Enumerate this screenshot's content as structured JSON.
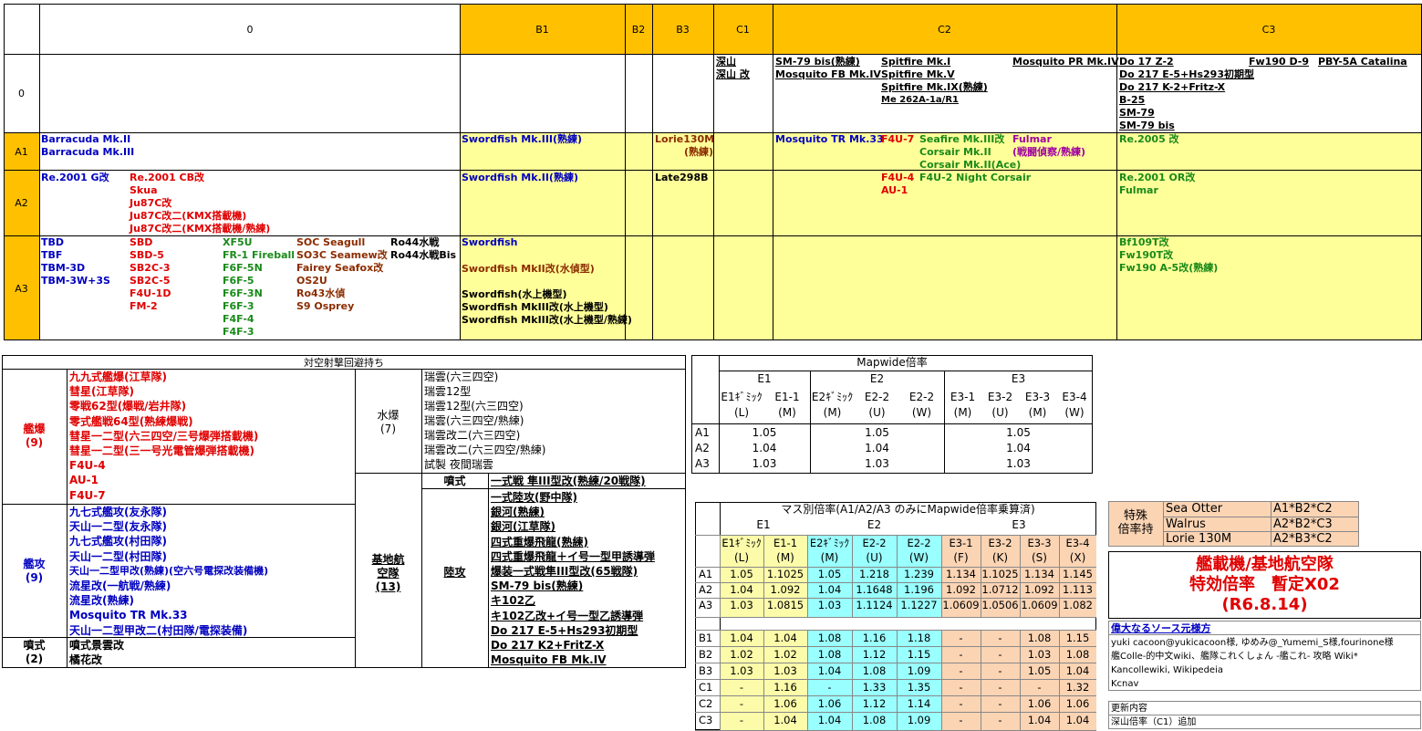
{
  "top": {
    "headers": [
      "0",
      "B1",
      "B2",
      "B3",
      "C1",
      "C2",
      "C3"
    ],
    "rows": [
      "0",
      "A1",
      "A2",
      "A3"
    ],
    "r0": {
      "c1": [
        "深山",
        "深山 改"
      ],
      "c2a": [
        "SM-79 bis(熟練)",
        "Mosquito FB Mk.IV"
      ],
      "c2b": [
        "Spitfire Mk.I",
        "Spitfire Mk.V",
        "Spitfire Mk.IX(熟練)",
        "Me 262A-1a/R1"
      ],
      "c2c": "Mosquito PR Mk.IV",
      "c3a": [
        "Do 17 Z-2",
        "Do 217 E-5+Hs293初期型",
        "Do 217 K-2+Fritz-X",
        "B-25",
        "SM-79",
        "SM-79 bis"
      ],
      "c3b": "Fw190 D-9",
      "c3c": "PBY-5A Catalina"
    },
    "a1": {
      "c0": [
        "Barracuda Mk.II",
        "Barracuda Mk.III"
      ],
      "b1": "Swordfish Mk.III(熟練)",
      "b3": [
        "Lorie130M",
        "(熟練)"
      ],
      "c2a": "Mosquito TR Mk.33",
      "c2b": "F4U-7",
      "c2c": [
        "Seafire Mk.III改",
        "Corsair Mk.II",
        "Corsair Mk.II(Ace)"
      ],
      "c2d": [
        "Fulmar",
        "(戦闘偵察/熟練)"
      ],
      "c3": "Re.2005 改"
    },
    "a2": {
      "c0a": "Re.2001 G改",
      "c0b": [
        "Re.2001 CB改",
        "Skua",
        "Ju87C改",
        "Ju87C改二(KMX搭載機)",
        "Ju87C改二(KMX搭載機/熟練)"
      ],
      "b1": "Swordfish Mk.II(熟練)",
      "b3": "Late298B",
      "c2a": [
        "F4U-4",
        "AU-1"
      ],
      "c2b": "F4U-2 Night Corsair",
      "c3": [
        "Re.2001 OR改",
        "Fulmar"
      ]
    },
    "a3": {
      "c0a": [
        "TBD",
        "TBF",
        "TBM-3D",
        "TBM-3W+3S"
      ],
      "c0b": [
        "SBD",
        "SBD-5",
        "SB2C-3",
        "SB2C-5",
        "F4U-1D",
        "FM-2"
      ],
      "c0c": [
        "XF5U",
        "FR-1 Fireball",
        "F6F-5N",
        "F6F-5",
        "F6F-3N",
        "F6F-3",
        "F4F-4",
        "F4F-3"
      ],
      "c0d": [
        "SOC Seagull",
        "SO3C Seamew改",
        "Fairey Seafox改",
        "OS2U",
        "Ro43水偵",
        "S9 Osprey"
      ],
      "c0e": [
        "Ro44水戦",
        "Ro44水戦Bis"
      ],
      "b1a": "Swordfish",
      "b1b": "Swordfish MkII改(水偵型)",
      "b1c": [
        "Swordfish(水上機型)",
        "Swordfish MkIII改(水上機型)",
        "Swordfish MkIII改(水上機型/熟練)"
      ],
      "c3a": [
        "Bf109T改",
        "Fw190T改"
      ],
      "c3b": "Fw190 A-5改(熟練)"
    }
  },
  "aa": {
    "title": "対空射撃回避持ち",
    "kanbaku": {
      "label": "艦爆",
      "count": "(9)",
      "items": [
        "九九式艦爆(江草隊)",
        "彗星(江草隊)",
        "零戦62型(爆戦/岩井隊)",
        "零式艦戦64型(熟練爆戦)",
        "彗星一二型(六三四空/三号爆弾搭載機)",
        "彗星一二型(三一号光電管爆弾搭載機)",
        "F4U-4",
        "AU-1",
        "F4U-7"
      ]
    },
    "kanko": {
      "label": "艦攻",
      "count": "(9)",
      "items": [
        "九七式艦攻(友永隊)",
        "天山一二型(友永隊)",
        "九七式艦攻(村田隊)",
        "天山一二型(村田隊)",
        "天山一二型甲改(熟練)(空六号電探改装備機)",
        "流星改(一航戦/熟練)",
        "流星改(熟練)",
        "Mosquito TR Mk.33",
        "天山一二型甲改二(村田隊/電探装備)"
      ]
    },
    "funshiki": {
      "label": "噴式",
      "count": "(2)",
      "items": [
        "噴式景雲改",
        "橘花改"
      ]
    },
    "suibaku": {
      "label": "水爆",
      "count": "(7)",
      "items": [
        "瑞雲(六三四空)",
        "瑞雲12型",
        "瑞雲12型(六三四空)",
        "瑞雲(六三四空/熟練)",
        "瑞雲改二(六三四空)",
        "瑞雲改二(六三四空/熟練)",
        "試製 夜間瑞雲"
      ]
    },
    "kichi": {
      "label": "基地航空隊",
      "count": "(13)",
      "sub1": "噴式",
      "sub1items": [
        "一式戦 隼III型改(熟練/20戦隊)"
      ],
      "sub2": "陸攻",
      "sub2items": [
        "一式陸攻(野中隊)",
        "銀河(熟練)",
        "銀河(江草隊)",
        "四式重爆飛龍(熟練)",
        "四式重爆飛龍＋イ号一型甲誘導弾",
        "爆装一式戦隼III型改(65戦隊)",
        "SM-79 bis(熟練)",
        "キ102乙",
        "キ102乙改+イ号一型乙誘導弾",
        "Do 217 E-5+Hs293初期型",
        "Do 217 K2+FritZ-X",
        "Mosquito FB Mk.IV"
      ]
    }
  },
  "mapwide": {
    "title": "Mapwide倍率",
    "groups": [
      "E1",
      "E2",
      "E3"
    ],
    "cols": [
      "E1ｷﾞﾐｯｸ",
      "E1-1",
      "E2ｷﾞﾐｯｸ",
      "E2-2",
      "E2-2",
      "E3-1",
      "E3-2",
      "E3-3",
      "E3-4"
    ],
    "sub": [
      "(L)",
      "(M)",
      "(M)",
      "(U)",
      "(W)",
      "(M)",
      "(U)",
      "(M)",
      "(W)"
    ],
    "rows": [
      [
        "A1",
        "1.05",
        "1.05",
        "1.05"
      ],
      [
        "A2",
        "1.04",
        "1.04",
        "1.04"
      ],
      [
        "A3",
        "1.03",
        "1.03",
        "1.03"
      ]
    ]
  },
  "mass": {
    "title": "マス別倍率(A1/A2/A3 のみにMapwide倍率乗算済)",
    "groups": [
      "E1",
      "E2",
      "E3"
    ],
    "cols": [
      "E1ｷﾞﾐｯｸ",
      "E1-1",
      "E2ｷﾞﾐｯｸ",
      "E2-2",
      "E2-2",
      "E3-1",
      "E3-2",
      "E3-3",
      "E3-4"
    ],
    "sub": [
      "(L)",
      "(M)",
      "(M)",
      "(U)",
      "(W)",
      "(F)",
      "(K)",
      "(S)",
      "(X)"
    ],
    "rowsA": [
      [
        "A1",
        "1.05",
        "1.1025",
        "1.05",
        "1.218",
        "1.239",
        "1.134",
        "1.1025",
        "1.134",
        "1.145"
      ],
      [
        "A2",
        "1.04",
        "1.092",
        "1.04",
        "1.1648",
        "1.196",
        "1.092",
        "1.0712",
        "1.092",
        "1.113"
      ],
      [
        "A3",
        "1.03",
        "1.0815",
        "1.03",
        "1.1124",
        "1.1227",
        "1.0609",
        "1.0506",
        "1.0609",
        "1.082"
      ]
    ],
    "rowsB": [
      [
        "B1",
        "1.04",
        "1.04",
        "1.08",
        "1.16",
        "1.18",
        "-",
        "-",
        "1.08",
        "1.15"
      ],
      [
        "B2",
        "1.02",
        "1.02",
        "1.08",
        "1.12",
        "1.15",
        "-",
        "-",
        "1.03",
        "1.08"
      ],
      [
        "B3",
        "1.03",
        "1.03",
        "1.04",
        "1.08",
        "1.09",
        "-",
        "-",
        "1.05",
        "1.04"
      ],
      [
        "C1",
        "-",
        "1.16",
        "-",
        "1.33",
        "1.35",
        "-",
        "-",
        "-",
        "1.32"
      ],
      [
        "C2",
        "-",
        "1.06",
        "1.06",
        "1.12",
        "1.14",
        "-",
        "-",
        "1.06",
        "1.06"
      ],
      [
        "C3",
        "-",
        "1.04",
        "1.04",
        "1.08",
        "1.09",
        "-",
        "-",
        "1.04",
        "1.04"
      ]
    ]
  },
  "special": {
    "label": [
      "特殊",
      "倍率持"
    ],
    "rows": [
      [
        "Sea Otter",
        "A1*B2*C2"
      ],
      [
        "Walrus",
        "A2*B2*C3"
      ],
      [
        "Lorie 130M",
        "A2*B3*C2"
      ]
    ]
  },
  "titlebox": {
    "line1": "艦載機/基地航空隊",
    "line2": "特効倍率　暫定X02",
    "line3": "(R6.8.14)"
  },
  "sources": {
    "heading": "偉大なるソース元様方",
    "lines": [
      "yuki cacoon@yukicacoon様, ゆめみ@_Yumemi_S様,fourinone様",
      "艦Colle-的中文wiki、艦隊これくしょん -艦これ- 攻略 Wiki*",
      "Kancollewiki, Wikipedeia",
      "Kcnav"
    ]
  },
  "update": {
    "heading": "更新内容",
    "line": "深山倍率（C1）追加"
  },
  "colors": {
    "orange": "#ffc000",
    "yellow": "#ffff99",
    "paleyellow": "#fbfbaa",
    "cyan": "#99ffff",
    "peach": "#fbd4b4",
    "blue": "#0000c0",
    "red": "#e00000",
    "green": "#1a8a1a"
  }
}
